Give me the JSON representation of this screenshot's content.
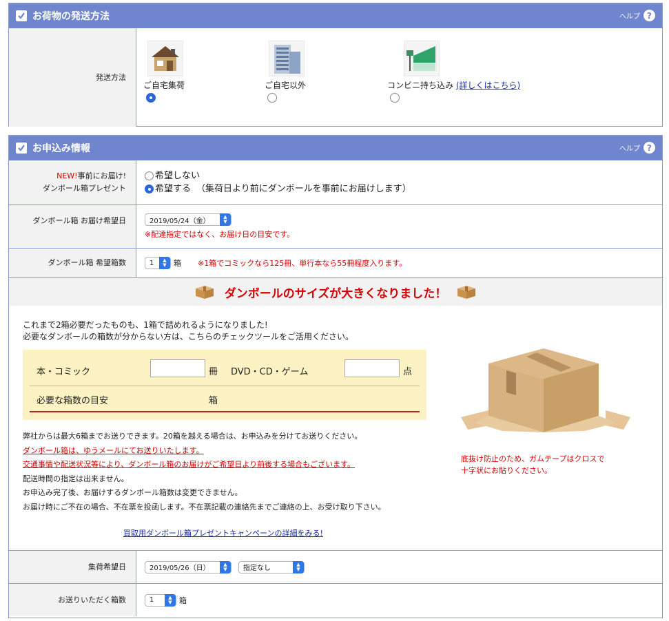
{
  "section1": {
    "title": "お荷物の発送方法",
    "help": "ヘルプ",
    "row_label": "発送方法",
    "options": [
      {
        "label": "ご自宅集荷",
        "selected": true,
        "icon": "house-icon"
      },
      {
        "label": "ご自宅以外",
        "selected": false,
        "icon": "building-icon"
      },
      {
        "label": "コンビニ持ち込み",
        "selected": false,
        "icon": "convenience-store-icon",
        "link": "(詳しくはこちら)"
      }
    ]
  },
  "section2": {
    "title": "お申込み情報",
    "help": "ヘルプ",
    "present": {
      "new": "NEW!",
      "label1": "事前にお届け!",
      "label2": "ダンボール箱プレゼント",
      "opt_no": "希望しない",
      "opt_yes": "希望する",
      "opt_yes_note": "（集荷日より前にダンボールを事前にお届けします）"
    },
    "delivery_date": {
      "label": "ダンボール箱 お届け希望日",
      "value": "2019/05/24（金）",
      "note": "※配達指定ではなく、お届け日の目安です。"
    },
    "box_count": {
      "label": "ダンボール箱 希望箱数",
      "value": "1",
      "unit": "箱",
      "note": "※1箱でコミックなら125冊、単行本なら55冊程度入ります。"
    },
    "banner": {
      "title": "ダンボールのサイズが大きくなりました！",
      "line1": "これまで2箱必要だったものも、1箱で詰めれるようになりました!",
      "line2": "必要なダンボールの箱数が分からない方は、こちらのチェックツールをご活用ください。"
    },
    "calc": {
      "book_label": "本・コミック",
      "book_unit": "冊",
      "media_label": "DVD・CD・ゲーム",
      "media_unit": "点",
      "result_label": "必要な箱数の目安",
      "result_unit": "箱"
    },
    "notes": [
      "弊社からは最大6箱までお送りできます。20箱を越える場合は、お申込みを分けてお送りください。",
      "ダンボール箱は、ゆうメールにてお送りいたします。",
      "交通事情や配送状況等により、ダンボール箱のお届けがご希望日より前後する場合もございます。",
      "配送時間の指定は出来ません。",
      "お申込み完了後、お届けするダンボール箱数は変更できません。",
      "お届け時にご不在の場合、不在票を投函します。不在票記載の連絡先までご連絡の上、お受け取り下さい。"
    ],
    "campaign_link": "買取用ダンボール箱プレゼントキャンペーンの詳細をみる!",
    "tape_note1": "底抜け防止のため、ガムテープはクロスで",
    "tape_note2": "十字状にお貼りください。",
    "pickup": {
      "label": "集荷希望日",
      "date": "2019/05/26（日）",
      "time": "指定なし"
    },
    "send_count": {
      "label": "お送りいただく箱数",
      "value": "1",
      "unit": "箱"
    }
  }
}
